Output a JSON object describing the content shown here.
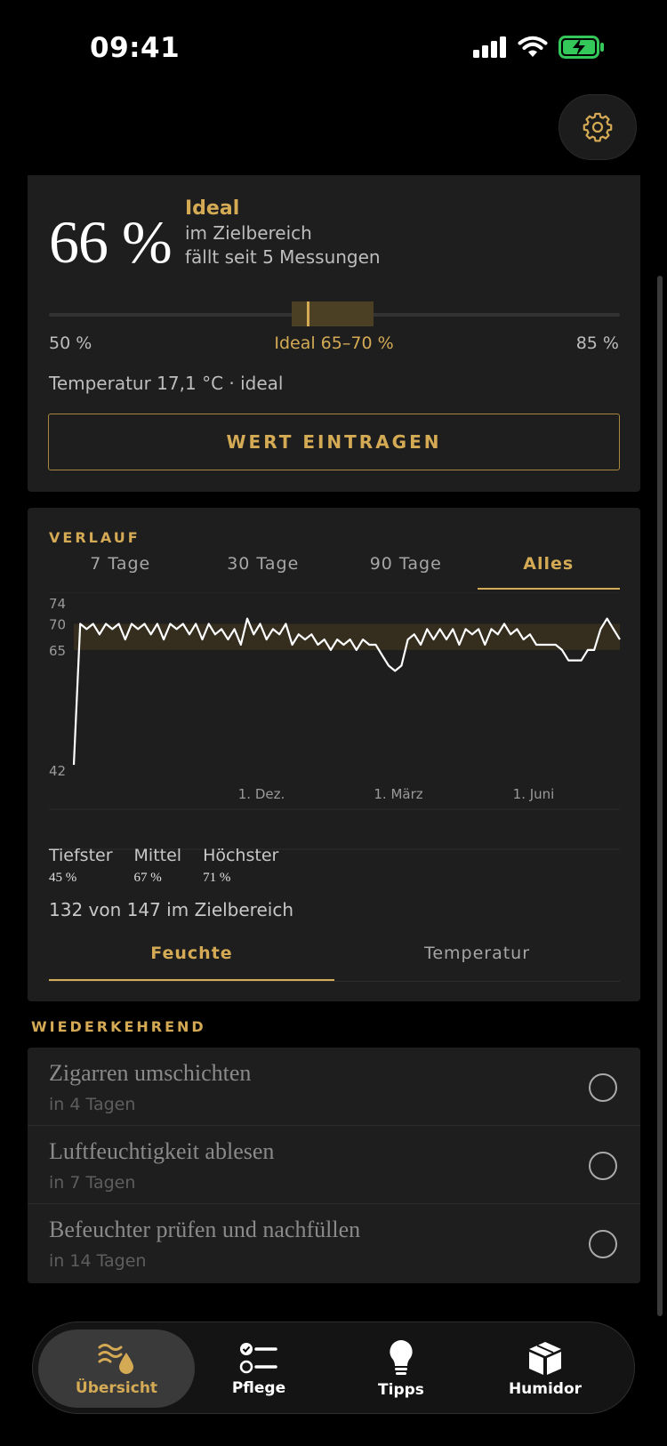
{
  "status_bar": {
    "time": "09:41"
  },
  "hero": {
    "value": "66 %",
    "status_title": "Ideal",
    "status_lines": [
      "im Zielbereich",
      "fällt seit 5 Messungen"
    ],
    "gauge": {
      "min_label": "50 %",
      "ideal_label": "Ideal 65–70 %",
      "max_label": "85 %",
      "min": 50,
      "max": 85,
      "ideal_min": 65,
      "ideal_max": 70,
      "value": 66
    },
    "temperature_line": "Temperatur 17,1 °C · ideal",
    "enter_button": "WERT EINTRAGEN"
  },
  "history": {
    "label": "VERLAUF",
    "range_tabs": [
      "7 Tage",
      "30 Tage",
      "90 Tage",
      "Alles"
    ],
    "active_range": "Alles",
    "stats": {
      "low_label": "Tiefster",
      "low_value": "45 %",
      "mean_label": "Mittel",
      "mean_value": "67 %",
      "high_label": "Höchster",
      "high_value": "71 %"
    },
    "in_range_text": "132 von 147 im Zielbereich",
    "metric_tabs": [
      "Feuchte",
      "Temperatur"
    ],
    "active_metric": "Feuchte"
  },
  "chart_data": {
    "type": "line",
    "title": "",
    "xlabel": "",
    "ylabel": "",
    "ylim": [
      42,
      74
    ],
    "y_ticks": [
      "74",
      "70",
      "65",
      "42"
    ],
    "x_ticks": [
      "1. Dez.",
      "1. März",
      "1. Juni"
    ],
    "target_band": [
      65,
      70
    ],
    "grid": false,
    "series": [
      {
        "values": [
          43,
          70,
          69,
          70,
          68,
          70,
          69,
          70,
          67,
          70,
          69,
          70,
          68,
          70,
          67,
          70,
          69,
          70,
          68,
          70,
          67,
          70,
          68,
          69,
          67,
          69,
          66,
          71,
          68,
          70,
          67,
          69,
          68,
          70,
          66,
          68,
          67,
          68,
          66,
          67,
          65,
          67,
          66,
          67,
          65,
          67,
          66,
          66,
          64,
          62,
          61,
          62,
          67,
          68,
          66,
          69,
          67,
          69,
          67,
          69,
          66,
          69,
          68,
          69,
          66,
          69,
          68,
          70,
          68,
          69,
          67,
          68,
          66,
          66,
          66,
          66,
          65,
          63,
          63,
          63,
          65,
          65,
          69,
          71,
          69,
          67
        ]
      }
    ]
  },
  "recurring": {
    "label": "WIEDERKEHREND",
    "tasks": [
      {
        "title": "Zigarren umschichten",
        "due": "in 4 Tagen"
      },
      {
        "title": "Luftfeuchtigkeit ablesen",
        "due": "in 7 Tagen"
      },
      {
        "title": "Befeuchter prüfen und nachfüllen",
        "due": "in 14 Tagen"
      }
    ]
  },
  "tabbar": {
    "items": [
      {
        "label": "Übersicht",
        "icon": "humidity-icon"
      },
      {
        "label": "Pflege",
        "icon": "checklist-icon"
      },
      {
        "label": "Tipps",
        "icon": "lightbulb-icon"
      },
      {
        "label": "Humidor",
        "icon": "box-icon"
      }
    ],
    "active": "Übersicht"
  },
  "colors": {
    "accent": "#d4aa55",
    "background": "#000000",
    "card": "#1e1e1e"
  }
}
